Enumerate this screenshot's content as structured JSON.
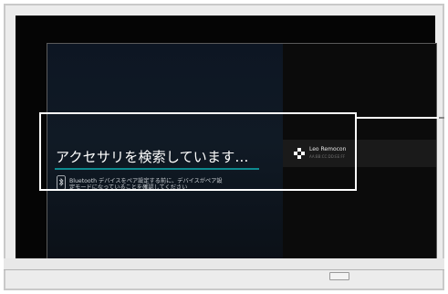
{
  "search_panel": {
    "title": "アクセサリを検索しています…",
    "info_line1": "Bluetooth デバイスをペア設定する前に、デバイスがペア設",
    "info_line2": "定モードになっていることを確認してください",
    "bluetooth_icon": "bluetooth-icon",
    "accent_color": "#0e8a8f"
  },
  "device_list": {
    "items": [
      {
        "name": "Leo Remocon",
        "address": "AA:BB:CC:DD:EE:FF",
        "icon": "gamepad-icon"
      }
    ]
  }
}
